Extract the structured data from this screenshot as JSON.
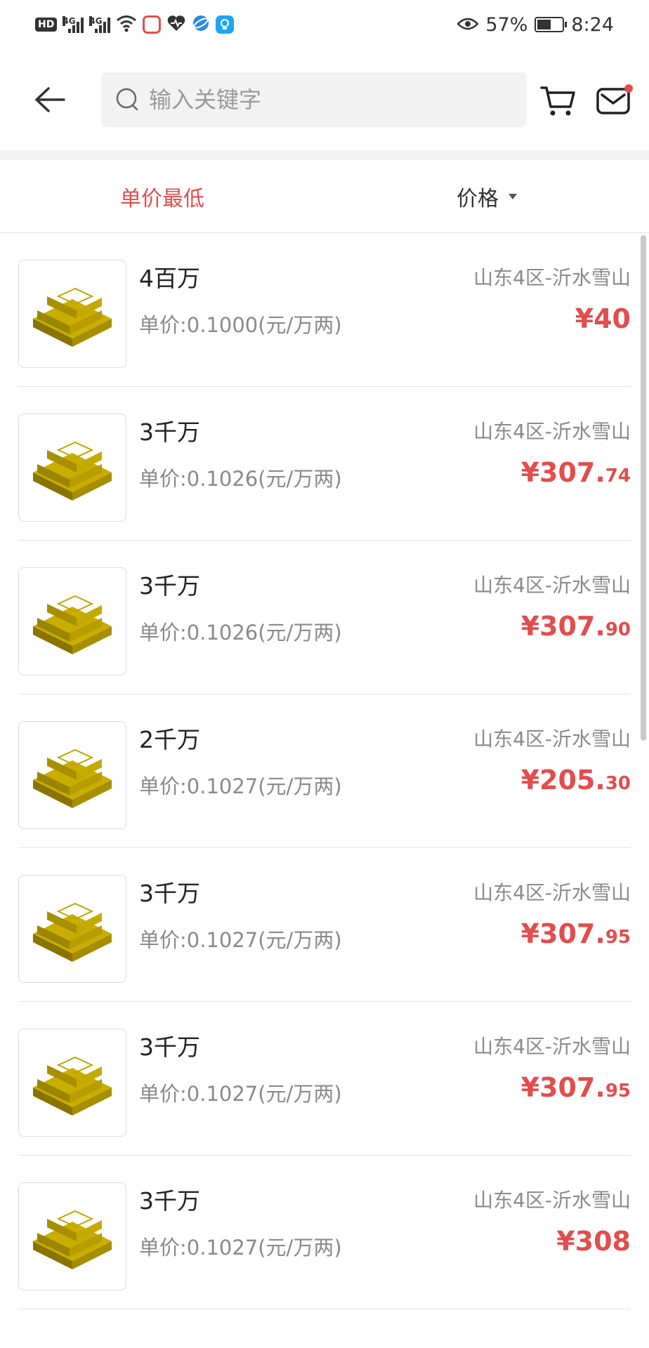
{
  "status_bar": {
    "left_badge": "HD",
    "signal_label_1": "4G",
    "signal_label_2": "4G",
    "battery_percent": "57%",
    "time": "8:24",
    "battery_level": 0.57
  },
  "header": {
    "search_placeholder": "输入关键字",
    "has_message_notification": true
  },
  "sort": {
    "option_1": "单价最低",
    "option_2": "价格",
    "active": "单价最低"
  },
  "colors": {
    "accent_red": "#e24d4d"
  },
  "listings": [
    {
      "title": "4百万",
      "unit_price": "单价:0.1000(元/万两)",
      "server": "山东4区-沂水雪山",
      "price_main": "¥40",
      "price_decimal": "",
      "icon": "gold-bars-icon"
    },
    {
      "title": "3千万",
      "unit_price": "单价:0.1026(元/万两)",
      "server": "山东4区-沂水雪山",
      "price_main": "¥307.",
      "price_decimal": "74",
      "icon": "gold-bars-icon"
    },
    {
      "title": "3千万",
      "unit_price": "单价:0.1026(元/万两)",
      "server": "山东4区-沂水雪山",
      "price_main": "¥307.",
      "price_decimal": "90",
      "icon": "gold-bars-icon"
    },
    {
      "title": "2千万",
      "unit_price": "单价:0.1027(元/万两)",
      "server": "山东4区-沂水雪山",
      "price_main": "¥205.",
      "price_decimal": "30",
      "icon": "gold-bars-icon"
    },
    {
      "title": "3千万",
      "unit_price": "单价:0.1027(元/万两)",
      "server": "山东4区-沂水雪山",
      "price_main": "¥307.",
      "price_decimal": "95",
      "icon": "gold-bars-icon"
    },
    {
      "title": "3千万",
      "unit_price": "单价:0.1027(元/万两)",
      "server": "山东4区-沂水雪山",
      "price_main": "¥307.",
      "price_decimal": "95",
      "icon": "gold-bars-icon"
    },
    {
      "title": "3千万",
      "unit_price": "单价:0.1027(元/万两)",
      "server": "山东4区-沂水雪山",
      "price_main": "¥308",
      "price_decimal": "",
      "icon": "gold-bars-icon"
    }
  ]
}
